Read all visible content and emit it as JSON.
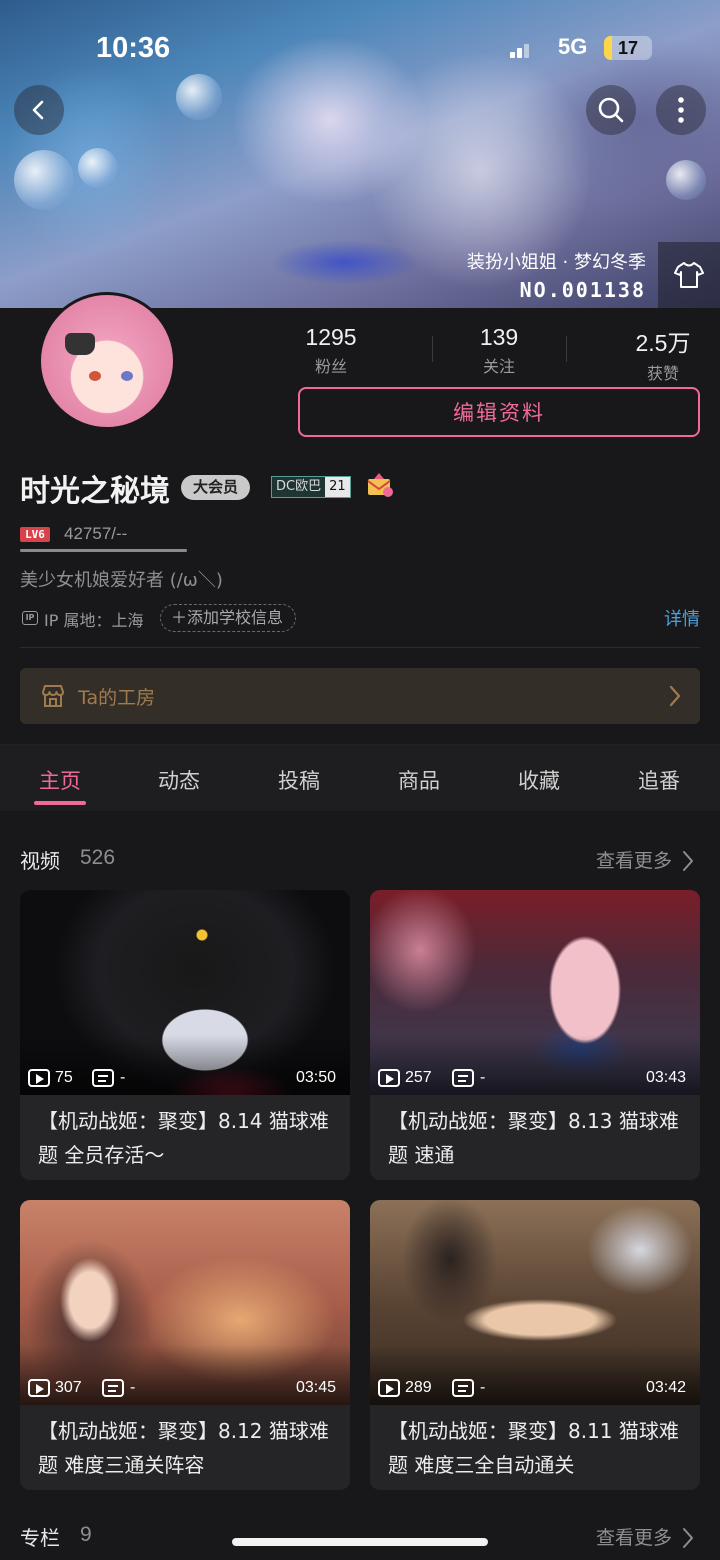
{
  "status_bar": {
    "time": "10:36",
    "network": "5G",
    "battery": "17",
    "battery_level": 0.17
  },
  "banner": {
    "theme_name": "装扮小姐姐 · 梦幻冬季",
    "theme_number": "NO.001138"
  },
  "profile": {
    "stats": [
      {
        "value": "1295",
        "label": "粉丝"
      },
      {
        "value": "139",
        "label": "关注"
      },
      {
        "value": "2.5万",
        "label": "获赞"
      }
    ],
    "edit_label": "编辑资料",
    "username": "时光之秘境",
    "vip_label": "大会员",
    "fan_badge": {
      "name": "DC欧巴",
      "level": "21"
    },
    "level_tag": "LV6",
    "exp": "42757/--",
    "bio": "美少女机娘爱好者 (/ω＼)",
    "ip_icon": "IP",
    "ip_location": "IP 属地：上海",
    "add_school": "添加学校信息",
    "details": "详情"
  },
  "workshop": {
    "label": "Ta的工房"
  },
  "tabs": [
    "主页",
    "动态",
    "投稿",
    "商品",
    "收藏",
    "追番"
  ],
  "active_tab": "主页",
  "videos_section": {
    "title": "视频",
    "count": "526",
    "more": "查看更多",
    "items": [
      {
        "views": "75",
        "danmaku": "-",
        "duration": "03:50",
        "title": "【机动战姬：聚变】8.14 猫球难题 全员存活～"
      },
      {
        "views": "257",
        "danmaku": "-",
        "duration": "03:43",
        "title": "【机动战姬：聚变】8.13 猫球难题 速通"
      },
      {
        "views": "307",
        "danmaku": "-",
        "duration": "03:45",
        "title": "【机动战姬：聚变】8.12 猫球难题 难度三通关阵容"
      },
      {
        "views": "289",
        "danmaku": "-",
        "duration": "03:42",
        "title": "【机动战姬：聚变】8.11 猫球难题 难度三全自动通关"
      }
    ]
  },
  "columns_section": {
    "title": "专栏",
    "count": "9",
    "more": "查看更多"
  },
  "colors": {
    "accent_pink": "#f06a99",
    "link_blue": "#4aa3df",
    "background": "#18181b",
    "workshop_gold": "#a07b4f"
  },
  "icons": [
    "back-icon",
    "search-icon",
    "more-icon",
    "shirt-icon",
    "envelope-icon",
    "shop-icon",
    "chevron-right-icon",
    "play-count-icon",
    "danmaku-icon"
  ]
}
